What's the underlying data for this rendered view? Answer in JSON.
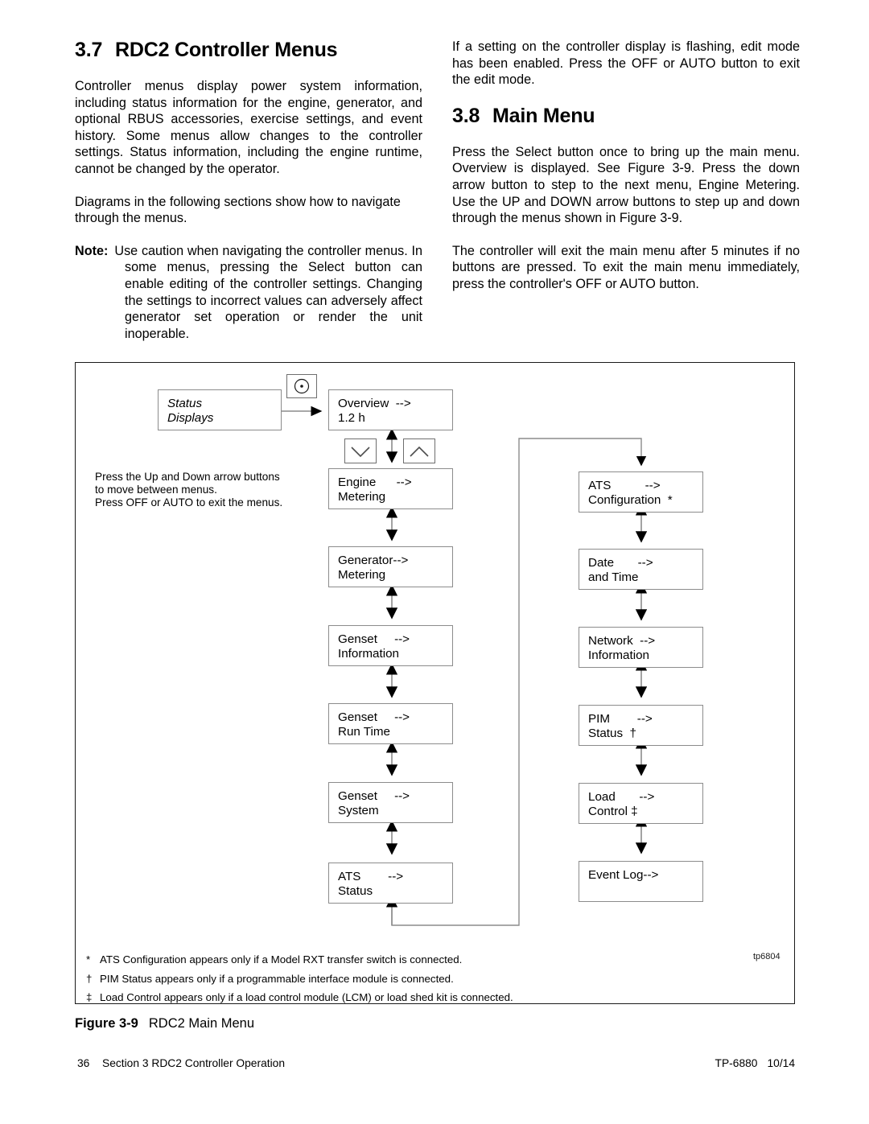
{
  "left_column": {
    "section_number": "3.7",
    "section_title": "RDC2 Controller Menus",
    "para1": "Controller menus display power system information, including status information for the engine, generator, and optional RBUS accessories, exercise settings, and event history. Some menus allow changes to the controller settings. Status information, including the engine runtime, cannot be changed by the operator.",
    "para2": "Diagrams in the following sections show how to navigate through the menus.",
    "note_label": "Note:",
    "note_text": "Use caution when navigating the controller menus. In some menus, pressing the Select button can enable editing of the controller settings. Changing the settings to incorrect values can adversely affect generator set operation or render the unit inoperable."
  },
  "right_column": {
    "para1": "If a setting on the controller display is flashing, edit mode has been enabled. Press the OFF or AUTO button to exit the edit mode.",
    "section_number": "3.8",
    "section_title": "Main Menu",
    "para2": "Press the Select button once to bring up the main menu. Overview is displayed. See Figure 3-9. Press the down arrow button to step to the next menu, Engine Metering. Use the UP and DOWN arrow buttons to step up and down through the menus shown in Figure 3-9.",
    "para3": "The controller will exit the main menu after 5 minutes if no buttons are pressed. To exit the main menu immediately, press the controller's OFF or AUTO button."
  },
  "figure": {
    "drawing_number": "tp6804",
    "hint_text": "Press the Up and Down arrow buttons\nto move between menus.\nPress OFF or AUTO to exit the menus.",
    "status_node": {
      "line1": "Status",
      "line2": "Displays"
    },
    "select_button_icon": "select-dot-icon",
    "down_button_icon": "down-chevron-icon",
    "up_button_icon": "up-chevron-icon",
    "menus_left": [
      {
        "line1": "Overview  -->",
        "line2": "1.2 h"
      },
      {
        "line1": "Engine      -->",
        "line2": "Metering"
      },
      {
        "line1": "Generator-->",
        "line2": "Metering"
      },
      {
        "line1": "Genset     -->",
        "line2": "Information"
      },
      {
        "line1": "Genset     -->",
        "line2": "Run Time"
      },
      {
        "line1": "Genset     -->",
        "line2": "System"
      },
      {
        "line1": "ATS        -->",
        "line2": "Status"
      }
    ],
    "menus_right": [
      {
        "line1": "ATS          -->",
        "line2": "Configuration  *"
      },
      {
        "line1": "Date       -->",
        "line2": "and Time"
      },
      {
        "line1": "Network  -->",
        "line2": "Information"
      },
      {
        "line1": "PIM        -->",
        "line2": "Status  †"
      },
      {
        "line1": "Load       -->",
        "line2": "Control ‡"
      },
      {
        "line1": "Event Log-->",
        "line2": ""
      }
    ],
    "footnotes": [
      {
        "mark": "*",
        "text": "ATS Configuration appears only if a Model RXT transfer switch is connected."
      },
      {
        "mark": "†",
        "text": "PIM Status appears only if a programmable interface module is connected."
      },
      {
        "mark": "‡",
        "text": "Load Control appears only if a load control module (LCM) or load shed kit is connected."
      }
    ]
  },
  "caption": {
    "label": "Figure 3-9",
    "title": "RDC2 Main Menu"
  },
  "footer": {
    "page_number": "36",
    "section_text": "Section 3 RDC2 Controller Operation",
    "doc_number": "TP-6880",
    "doc_date": "10/14"
  }
}
